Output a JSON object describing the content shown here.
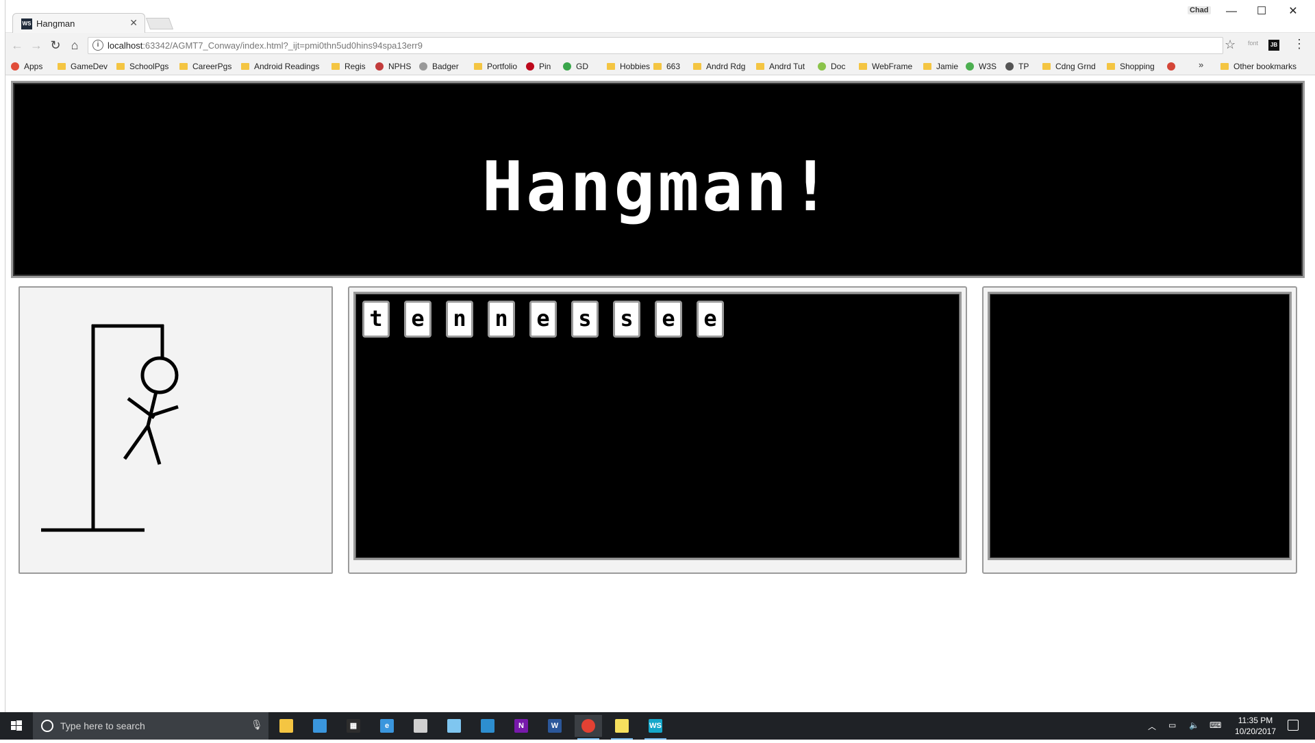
{
  "browser": {
    "tab_title": "Hangman",
    "tab_close": "✕",
    "user_label": "Chad",
    "window_controls": {
      "minimize": "—",
      "maximize": "☐",
      "close": "✕"
    },
    "url_host": "localhost",
    "url_rest": ":63342/AGMT7_Conway/index.html?_ijt=pmi0thn5ud0hins94spa13err9",
    "nav": {
      "back": "←",
      "forward": "→",
      "reload": "↻",
      "home": "⌂"
    },
    "star": "☆",
    "ext_font_label": "font",
    "ext_jb_label": "JB",
    "menu": "⋮",
    "bookmarks_overflow": "»",
    "bookmarks": [
      {
        "label": "Apps",
        "icon": "apps-icon"
      },
      {
        "label": "GameDev",
        "icon": "folder-icon"
      },
      {
        "label": "SchoolPgs",
        "icon": "folder-icon"
      },
      {
        "label": "CareerPgs",
        "icon": "folder-icon"
      },
      {
        "label": "Android Readings",
        "icon": "folder-icon"
      },
      {
        "label": "Regis",
        "icon": "folder-icon"
      },
      {
        "label": "NPHS",
        "icon": "nphs-icon"
      },
      {
        "label": "Badger",
        "icon": "badger-icon"
      },
      {
        "label": "Portfolio",
        "icon": "folder-icon"
      },
      {
        "label": "Pin",
        "icon": "pinterest-icon"
      },
      {
        "label": "GD",
        "icon": "gd-icon"
      },
      {
        "label": "Hobbies",
        "icon": "folder-icon"
      },
      {
        "label": "663",
        "icon": "folder-icon"
      },
      {
        "label": "Andrd Rdg",
        "icon": "folder-icon"
      },
      {
        "label": "Andrd Tut",
        "icon": "folder-icon"
      },
      {
        "label": "Doc",
        "icon": "android-icon"
      },
      {
        "label": "WebFrame",
        "icon": "folder-icon"
      },
      {
        "label": "Jamie",
        "icon": "folder-icon"
      },
      {
        "label": "W3S",
        "icon": "w3s-icon"
      },
      {
        "label": "TP",
        "icon": "tp-icon"
      },
      {
        "label": "Cdng Grnd",
        "icon": "folder-icon"
      },
      {
        "label": "Shopping",
        "icon": "folder-icon"
      },
      {
        "label": "",
        "icon": "gmail-icon"
      },
      {
        "label": "Other bookmarks",
        "icon": "folder-icon"
      }
    ]
  },
  "game": {
    "title": "Hangman!",
    "letters": [
      "t",
      "e",
      "n",
      "n",
      "e",
      "s",
      "s",
      "e",
      "e"
    ],
    "hangman_parts_shown": [
      "head",
      "body",
      "left-arm",
      "right-arm",
      "left-leg",
      "right-leg"
    ]
  },
  "taskbar": {
    "search_placeholder": "Type here to search",
    "time": "11:35 PM",
    "date": "10/20/2017",
    "apps": [
      {
        "name": "file-explorer",
        "glyph": "",
        "color": "#f4c542"
      },
      {
        "name": "mail",
        "glyph": "",
        "color": "#3a96dd"
      },
      {
        "name": "calculator",
        "glyph": "▦",
        "color": "#2d2d2d"
      },
      {
        "name": "edge",
        "glyph": "e",
        "color": "#3a96dd"
      },
      {
        "name": "printer",
        "glyph": "",
        "color": "#d0d0d0"
      },
      {
        "name": "paint",
        "glyph": "",
        "color": "#7fc6f0"
      },
      {
        "name": "visual-studio",
        "glyph": "",
        "color": "#2d8ecf"
      },
      {
        "name": "onenote",
        "glyph": "N",
        "color": "#7719aa"
      },
      {
        "name": "word",
        "glyph": "W",
        "color": "#2b579a"
      },
      {
        "name": "chrome",
        "glyph": "",
        "color": "#e34133"
      },
      {
        "name": "sticky-notes",
        "glyph": "",
        "color": "#f6e05e"
      },
      {
        "name": "webstorm",
        "glyph": "WS",
        "color": "#14a7c9"
      }
    ]
  }
}
